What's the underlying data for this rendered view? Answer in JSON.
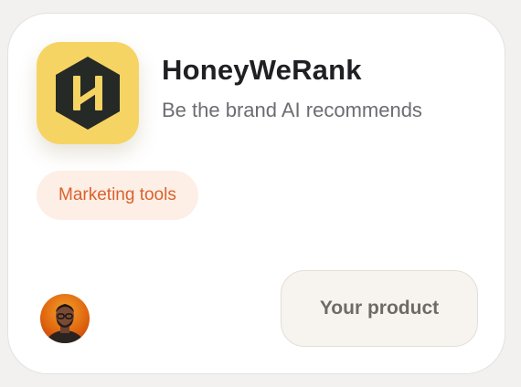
{
  "product": {
    "name": "HoneyWeRank",
    "tagline": "Be the brand AI recommends",
    "icon": "honeywerank-hexagon-logo"
  },
  "category": {
    "label": "Marketing tools"
  },
  "maker": {
    "avatar": "maker-avatar"
  },
  "cta": {
    "label": "Your product"
  },
  "colors": {
    "logo_background": "#f6d463",
    "logo_hexagon": "#262a26",
    "tag_background": "#fdeee6",
    "tag_text": "#d9622b",
    "cta_background": "#f7f4ef"
  }
}
